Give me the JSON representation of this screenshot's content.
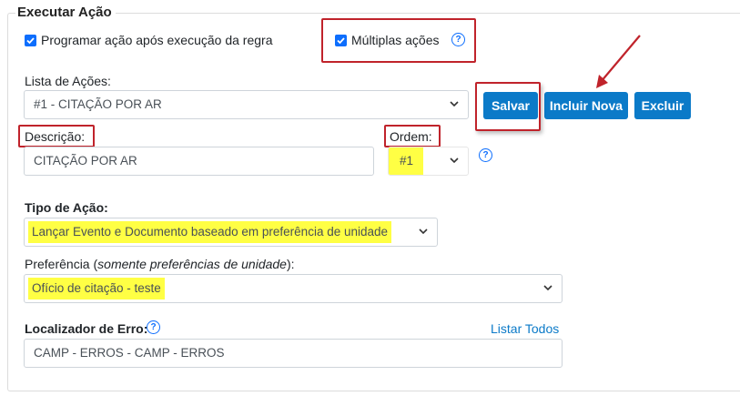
{
  "section": {
    "title": "Executar Ação"
  },
  "options": {
    "schedule_label": "Programar ação após execução da regra",
    "schedule_checked": true,
    "multiple_label": "Múltiplas ações",
    "multiple_checked": true
  },
  "actions_list": {
    "label": "Lista de Ações:",
    "selected": "#1 - CITAÇÃO POR AR"
  },
  "buttons": {
    "save": "Salvar",
    "add_new": "Incluir Nova",
    "delete": "Excluir"
  },
  "description": {
    "label": "Descrição:",
    "value": "CITAÇÃO POR AR"
  },
  "order": {
    "label": "Ordem:",
    "selected": "#1"
  },
  "action_type": {
    "label": "Tipo de Ação:",
    "selected": "Lançar Evento e Documento baseado em preferência de unidade"
  },
  "preference": {
    "label_prefix": "Preferência (",
    "label_italic": "somente preferências de unidade",
    "label_suffix": "):",
    "selected": "Ofício de citação - teste"
  },
  "error_locator": {
    "label": "Localizador de Erro:",
    "list_all": "Listar Todos",
    "value": "CAMP - ERROS - CAMP - ERROS"
  },
  "help_glyph": "?",
  "colors": {
    "primary_button": "#0b7ac8",
    "highlight": "#ffff44",
    "annotation_red": "#c0232b",
    "checkbox": "#0d6efd"
  },
  "icons": [
    "check-icon",
    "help-circle-icon",
    "chevron-down-icon",
    "red-annotation-arrow"
  ]
}
